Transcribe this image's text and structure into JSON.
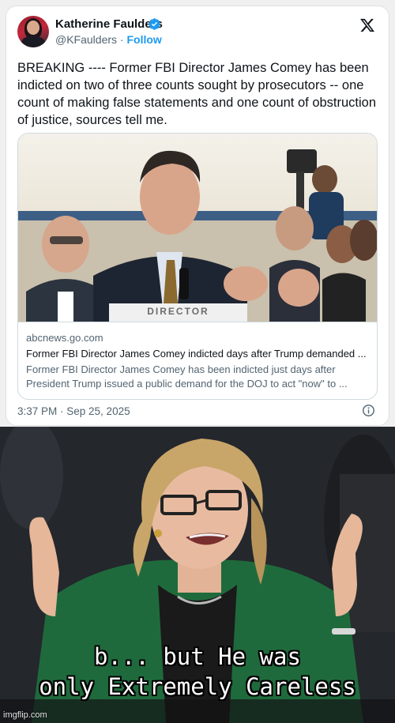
{
  "tweet": {
    "author_name": "Katherine Faulders",
    "handle": "@KFaulders",
    "separator": "·",
    "follow_label": "Follow",
    "text": "BREAKING ---- Former FBI Director James Comey has been indicted on two of three counts sought by prosecutors -- one count of making false statements and one count of obstruction of justice, sources tell me.",
    "timestamp": "3:37 PM · Sep 25, 2025"
  },
  "link_card": {
    "image_placard": "DIRECTOR",
    "domain": "abcnews.go.com",
    "title": "Former FBI Director James Comey indicted days after Trump demanded ...",
    "description": "Former FBI Director James Comey has been indicted just days after President Trump issued a public demand for the DOJ to act \"now\" to ..."
  },
  "meme": {
    "caption_line1": "b... but He was",
    "caption_line2": "only Extremely Careless",
    "watermark": "imgflip.com"
  },
  "colors": {
    "accent": "#1d9bf0",
    "text_primary": "#0f1419",
    "text_secondary": "#536471"
  },
  "icons": {
    "verified": "verified-badge-icon",
    "platform": "x-logo-icon",
    "info": "info-icon"
  }
}
